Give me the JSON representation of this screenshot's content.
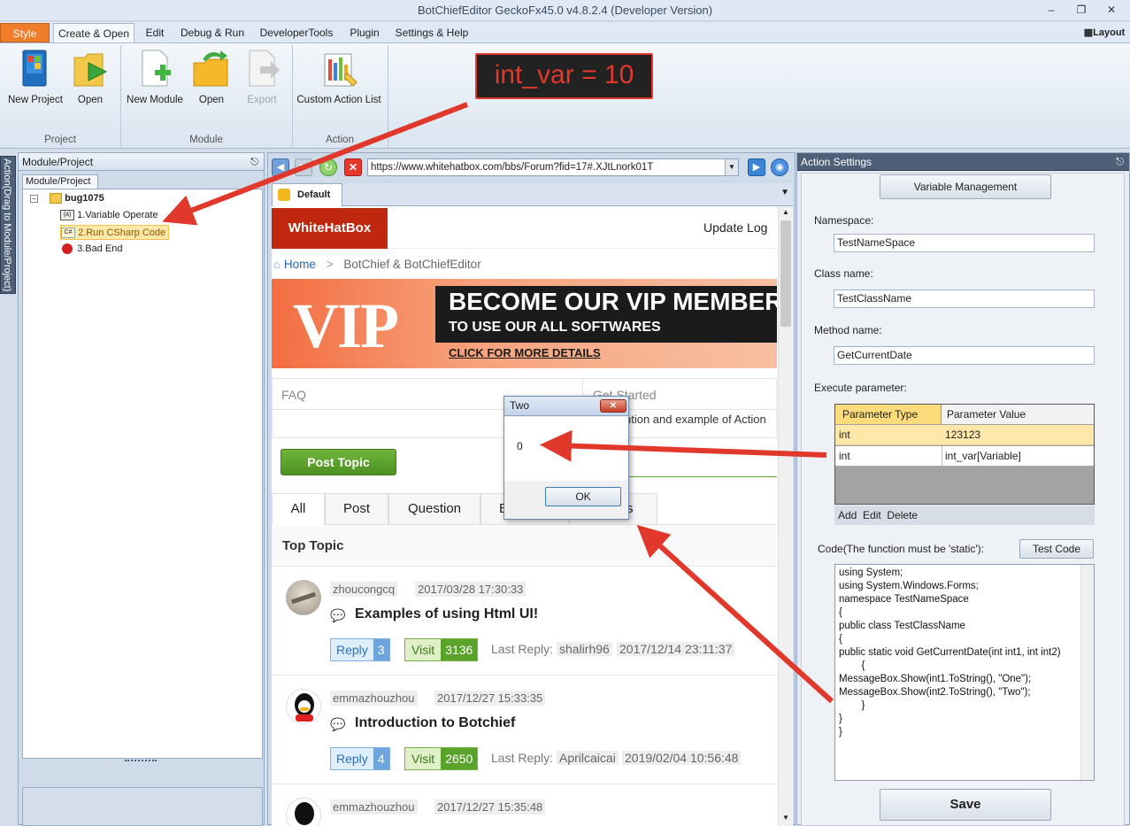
{
  "window": {
    "title": "BotChiefEditor GeckoFx45.0 v4.8.2.4 (Developer Version)"
  },
  "menu": {
    "style": "Style",
    "tabs": [
      "Create & Open",
      "Edit",
      "Debug & Run",
      "DeveloperTools",
      "Plugin",
      "Settings & Help"
    ],
    "layout": "Layout"
  },
  "ribbon": {
    "new_project": "New Project",
    "open_project": "Open",
    "group_project": "Project",
    "new_module": "New Module",
    "open_module": "Open",
    "export": "Export",
    "group_module": "Module",
    "custom_action_list": "Custom Action List",
    "group_action": "Action"
  },
  "callout": {
    "text": "int_var = 10"
  },
  "side_strip": {
    "label": "Action(Drag to Module/Project)"
  },
  "left_panel": {
    "title": "Module/Project",
    "tab": "Module/Project",
    "tree": {
      "root": "bug1075",
      "items": [
        "1.Variable Operate",
        "2.Run CSharp Code",
        "3.Bad End"
      ]
    }
  },
  "browser": {
    "url": "https://www.whitehatbox.com/bbs/Forum?fid=17#.XJtLnork01T",
    "tab": "Default"
  },
  "web": {
    "brand": "WhiteHatBox",
    "update_log": "Update Log",
    "breadcrumb_home": "Home",
    "breadcrumb_sep": ">",
    "breadcrumb_current": "BotChief & BotChiefEditor",
    "banner": {
      "logo": "VIP",
      "headline": "BECOME OUR VIP MEMBER",
      "sub": "TO USE OUR ALL SOFTWARES",
      "cta": "CLICK FOR MORE DETAILS"
    },
    "faq": "FAQ",
    "get_started": "Get Started",
    "get_started_desc": "ntion and example of Action",
    "post_topic": "Post Topic",
    "filters": [
      "All",
      "Post",
      "Question",
      "E",
      "s"
    ],
    "section_title": "Top Topic",
    "topics": [
      {
        "user": "zhoucongcq",
        "date": "2017/03/28 17:30:33",
        "title": "Examples of using Html UI!",
        "reply_label": "Reply",
        "replies": "3",
        "visit_label": "Visit",
        "visits": "3136",
        "last_label": "Last Reply:",
        "last_user": "shalirh96",
        "last_date": "2017/12/14 23:11:37"
      },
      {
        "user": "emmazhouzhou",
        "date": "2017/12/27 15:33:35",
        "title": "Introduction to Botchief",
        "reply_label": "Reply",
        "replies": "4",
        "visit_label": "Visit",
        "visits": "2650",
        "last_label": "Last Reply:",
        "last_user": "Aprilcaicai",
        "last_date": "2019/02/04 10:56:48"
      },
      {
        "user": "emmazhouzhou",
        "date": "2017/12/27 15:35:48"
      }
    ]
  },
  "dialog": {
    "title": "Two",
    "message": "0",
    "ok": "OK"
  },
  "right_panel": {
    "title": "Action Settings",
    "variable_management": "Variable Management",
    "namespace_label": "Namespace:",
    "namespace_value": "TestNameSpace",
    "class_label": "Class name:",
    "class_value": "TestClassName",
    "method_label": "Method name:",
    "method_value": "GetCurrentDate",
    "execute_label": "Execute parameter:",
    "param_headers": [
      "Parameter Type",
      "Parameter Value"
    ],
    "params": [
      {
        "type": "int",
        "value": "123123"
      },
      {
        "type": "int",
        "value": "int_var[Variable]"
      }
    ],
    "param_actions": [
      "Add",
      "Edit",
      "Delete"
    ],
    "code_label": "Code(The function must be 'static'):",
    "test_code": "Test Code",
    "code_lines": [
      "using System;",
      "using System.Windows.Forms;",
      "namespace TestNameSpace",
      "{",
      "public class TestClassName",
      "{",
      "public static void GetCurrentDate(int int1, int int2)",
      "        {",
      "MessageBox.Show(int1.ToString(), \"One\");",
      "MessageBox.Show(int2.ToString(), \"Two\");",
      "        }",
      "}",
      "}"
    ],
    "save": "Save"
  },
  "colors": {
    "accent_orange": "#f07d2a",
    "brand_red": "#c0270f",
    "arrow_red": "#e0392c",
    "selected_row": "#fde7a9",
    "post_green": "#5aa32a"
  }
}
